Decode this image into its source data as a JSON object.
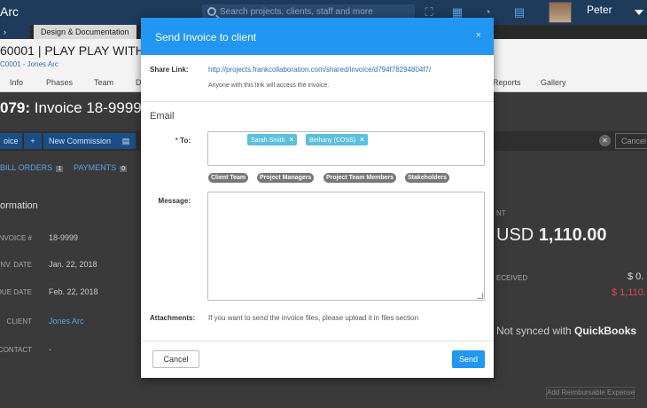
{
  "app": {
    "title": "Arc",
    "search_placeholder": "Search projects, clients, staff and more",
    "user_name": "Peter",
    "breadcrumb_back": "›",
    "breadcrumb_tab": "Design & Documentation"
  },
  "project": {
    "title": "60001 | PLAY PLAY WITH",
    "subtitle": "C0001 - Jones Arc"
  },
  "nav": [
    "Info",
    "Phases",
    "Team",
    "D",
    "Reports",
    "Gallery"
  ],
  "invoice": {
    "number_prefix": "079:",
    "name": "Invoice 18-9999"
  },
  "toolbar": {
    "invoice_btn": "oice",
    "plus_icon": "+",
    "new_commission": "New Commission",
    "doc_icon": "▤",
    "cancel_btn": "Cancel",
    "x_icon": "✕"
  },
  "subtabs": {
    "bill_orders": "BILL ORDERS",
    "bill_orders_count": "1",
    "payments": "PAYMENTS",
    "payments_count": "0"
  },
  "info": {
    "title": "ormation",
    "rows": [
      {
        "label": "INVOICE #",
        "value": "18-9999"
      },
      {
        "label": "INV. DATE",
        "value": "Jan. 22, 2018"
      },
      {
        "label": "DUE DATE",
        "value": "Feb. 22, 2018"
      },
      {
        "label": "CLIENT",
        "value": "Jones Arc"
      },
      {
        "label": "T CONTACT",
        "value": "-"
      }
    ]
  },
  "summary": {
    "amount_label": "NT",
    "currency": "USD",
    "amount": "1,110.00",
    "received_label": "ECEIVED",
    "received_value": "$ 0.",
    "due_value": "$ 1,110.",
    "qb_prefix": "Not synced with",
    "qb_name": "QuickBooks",
    "reimbursable_btn": "Add Reimbursable Expense"
  },
  "modal": {
    "title": "Send Invoice to client",
    "close": "×",
    "share_label": "Share Link:",
    "share_link": "http://projects.frankcollaboration.com/shared/invoice/d794f78294804f7/",
    "share_note": "Anyone with this link will access the invoice.",
    "email_heading": "Email",
    "to_label": "To:",
    "required_mark": "*",
    "recipients": [
      {
        "name": "Sarah Smith",
        "remove": "×"
      },
      {
        "name": "Bethany (COSS)",
        "remove": "×"
      }
    ],
    "groups": [
      "Client Team",
      "Project Managers",
      "Project Team Members",
      "Stakeholders"
    ],
    "message_label": "Message:",
    "message_value": "",
    "attachments_label": "Attachments:",
    "attachments_note": "If you want to send the invoice files, please upload it in files section",
    "cancel_label": "Cancel",
    "send_label": "Send"
  },
  "colors": {
    "modal_header": "#2196f3",
    "tag": "#5bc0de",
    "group_tag": "#777777",
    "topbar": "#1f3b5c"
  }
}
